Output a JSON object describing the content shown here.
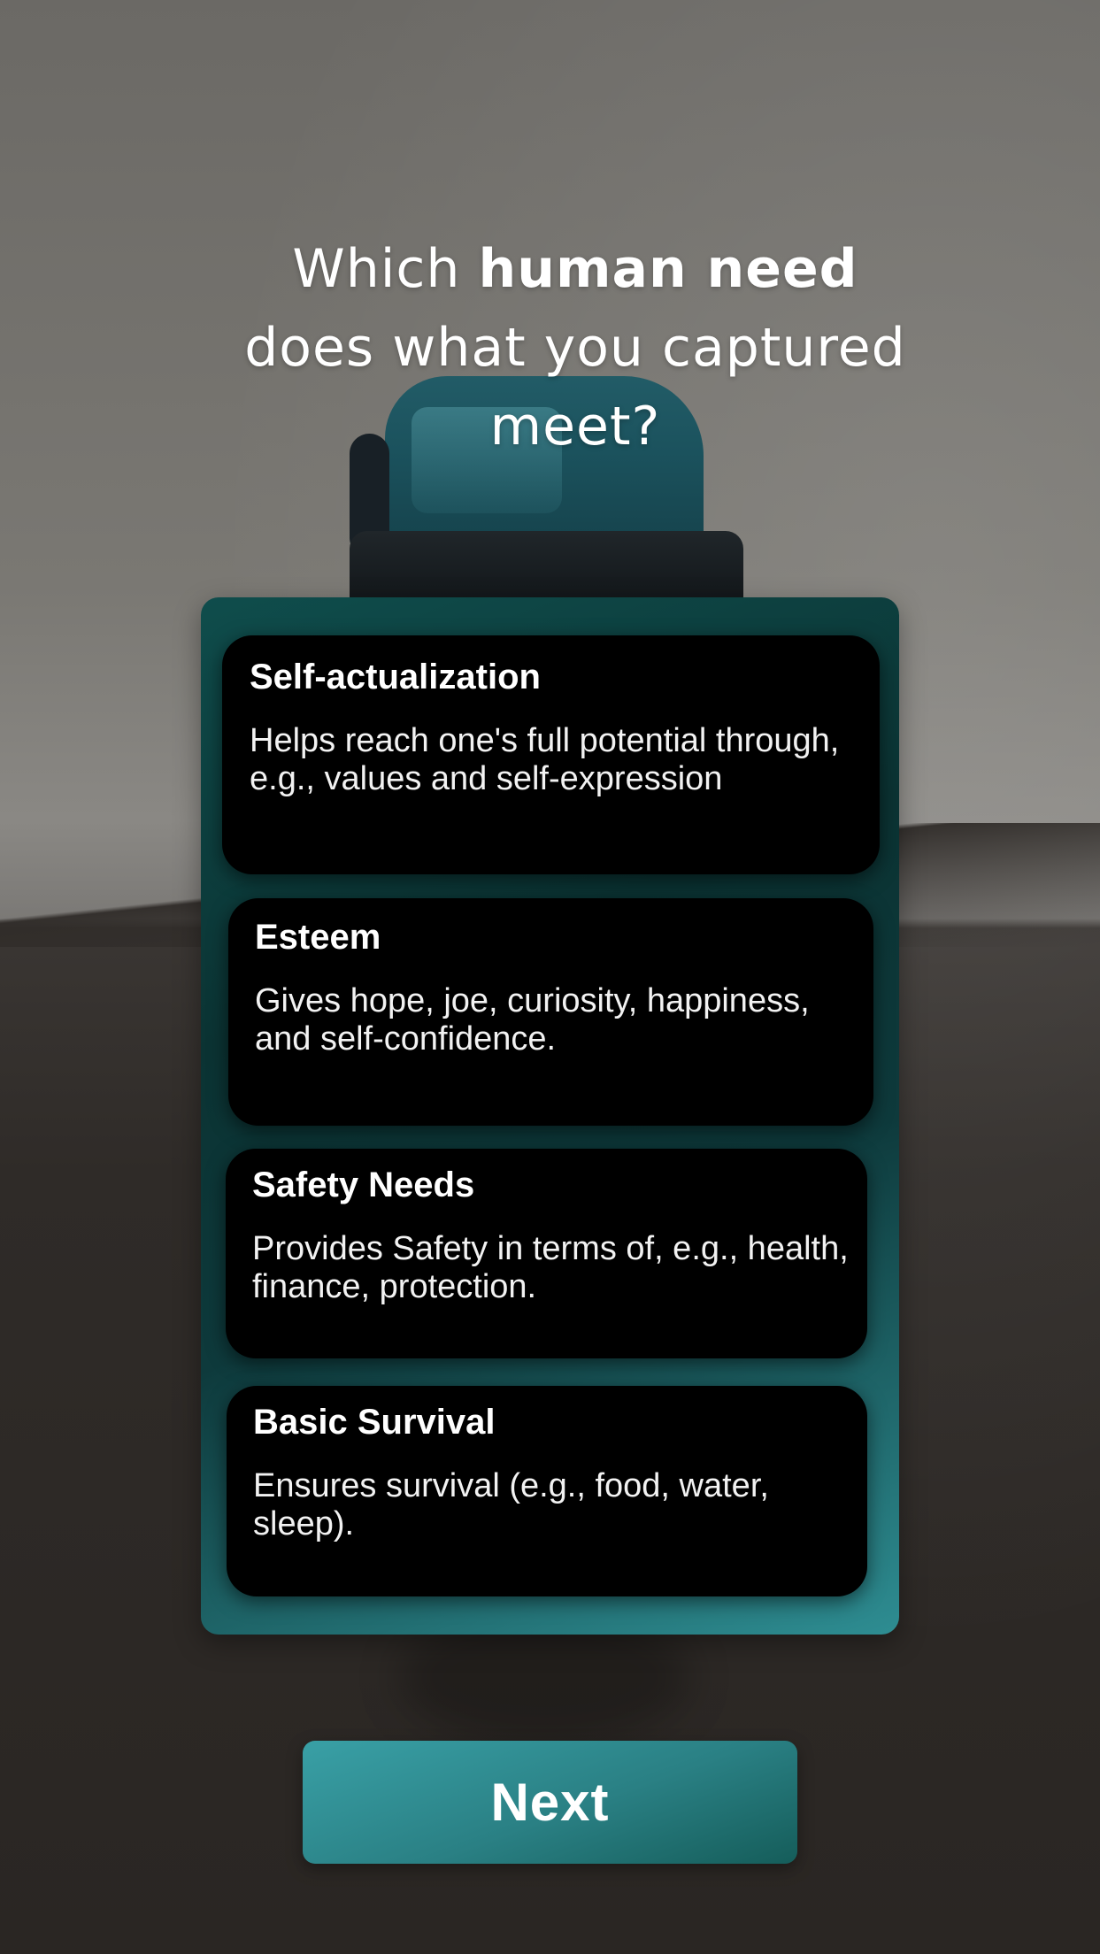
{
  "question": {
    "prefix": "Which ",
    "emphasis": "human need",
    "suffix": " does what you captured meet?"
  },
  "options": [
    {
      "title": "Self-actualization",
      "description": "Helps reach one's full potential through, e.g., values and self-expression"
    },
    {
      "title": "Esteem",
      "description": "Gives hope, joe, curiosity, happiness, and self-confidence."
    },
    {
      "title": "Safety Needs",
      "description": "Provides Safety in terms of, e.g., health, finance, protection."
    },
    {
      "title": "Basic Survival",
      "description": "Ensures survival (e.g., food, water, sleep)."
    }
  ],
  "next_button": {
    "label": "Next"
  },
  "colors": {
    "panel_teal": "#0b3333",
    "button_teal": "#2a8084",
    "card_background": "#000000",
    "text": "#ffffff"
  },
  "background": {
    "subject_icon": "water-bottle-photo"
  }
}
